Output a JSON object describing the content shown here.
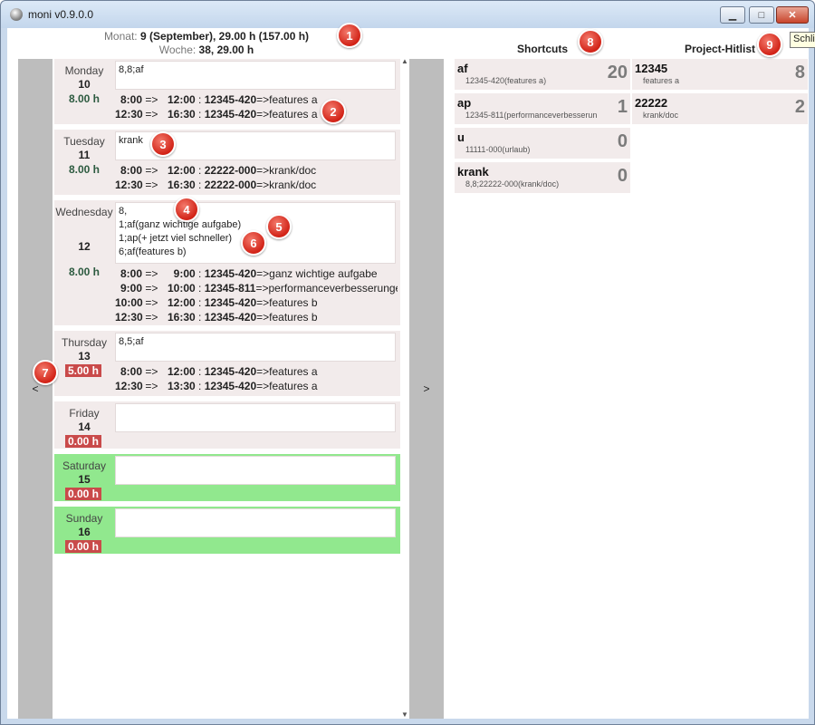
{
  "window": {
    "title": "moni v0.9.0.0",
    "controls": {
      "minimize": "▁",
      "maximize": "□",
      "close": "✕"
    }
  },
  "summary": {
    "month_label": "Monat:",
    "month_value": "9 (September), 29.00 h (157.00 h)",
    "week_label": "Woche:",
    "week_value": "38, 29.00 h"
  },
  "nav": {
    "prev": "<",
    "next": ">"
  },
  "days": [
    {
      "name": "Monday",
      "num": "10",
      "hours": "8.00 h",
      "hours_red": false,
      "input": "8,8;af",
      "entries": [
        {
          "start": "8:00",
          "end": "12:00",
          "code": "12345-420",
          "desc": "features a"
        },
        {
          "start": "12:30",
          "end": "16:30",
          "code": "12345-420",
          "desc": "features a"
        }
      ]
    },
    {
      "name": "Tuesday",
      "num": "11",
      "hours": "8.00 h",
      "hours_red": false,
      "input": "krank",
      "entries": [
        {
          "start": "8:00",
          "end": "12:00",
          "code": "22222-000",
          "desc": "krank/doc"
        },
        {
          "start": "12:30",
          "end": "16:30",
          "code": "22222-000",
          "desc": "krank/doc"
        }
      ]
    },
    {
      "name": "Wednesday",
      "num": "12",
      "hours": "8.00 h",
      "hours_red": false,
      "input": "8,\n1;af(ganz wichtige aufgabe)\n1;ap(+ jetzt viel schneller)\n6;af(features b)",
      "entries": [
        {
          "start": "8:00",
          "end": "9:00",
          "code": "12345-420",
          "desc": "ganz wichtige aufgabe"
        },
        {
          "start": "9:00",
          "end": "10:00",
          "code": "12345-811",
          "desc": "performanceverbesserungen"
        },
        {
          "start": "10:00",
          "end": "12:00",
          "code": "12345-420",
          "desc": "features b"
        },
        {
          "start": "12:30",
          "end": "16:30",
          "code": "12345-420",
          "desc": "features b"
        }
      ]
    },
    {
      "name": "Thursday",
      "num": "13",
      "hours": "5.00 h",
      "hours_red": true,
      "input": "8,5;af",
      "entries": [
        {
          "start": "8:00",
          "end": "12:00",
          "code": "12345-420",
          "desc": "features a"
        },
        {
          "start": "12:30",
          "end": "13:30",
          "code": "12345-420",
          "desc": "features a"
        }
      ]
    },
    {
      "name": "Friday",
      "num": "14",
      "hours": "0.00 h",
      "hours_red": true,
      "input": "",
      "entries": []
    },
    {
      "name": "Saturday",
      "num": "15",
      "hours": "0.00 h",
      "hours_red": true,
      "input": "",
      "entries": []
    },
    {
      "name": "Sunday",
      "num": "16",
      "hours": "0.00 h",
      "hours_red": true,
      "input": "",
      "entries": []
    }
  ],
  "entry_arrow": "=>",
  "entry_sep": ":",
  "shortcuts": {
    "title": "Shortcuts",
    "items": [
      {
        "name": "af",
        "sub": "12345-420(features a)",
        "count": "20"
      },
      {
        "name": "ap",
        "sub": "12345-811(performanceverbesserun",
        "count": "1"
      },
      {
        "name": "u",
        "sub": "11111-000(urlaub)",
        "count": "0"
      },
      {
        "name": "krank",
        "sub": "8,8;22222-000(krank/doc)",
        "count": "0"
      }
    ]
  },
  "hitlist": {
    "title": "Project-Hitlist",
    "items": [
      {
        "name": "12345",
        "sub": "features a",
        "count": "8"
      },
      {
        "name": "22222",
        "sub": "krank/doc",
        "count": "2"
      }
    ]
  },
  "tooltip": "Schli",
  "badges": [
    "1",
    "2",
    "3",
    "4",
    "5",
    "6",
    "7",
    "8",
    "9"
  ],
  "colors": {
    "weekend": "#91e88e",
    "weekday": "#f2ebeb",
    "hours_red": "#c94a4a",
    "badge": "#d22317"
  }
}
